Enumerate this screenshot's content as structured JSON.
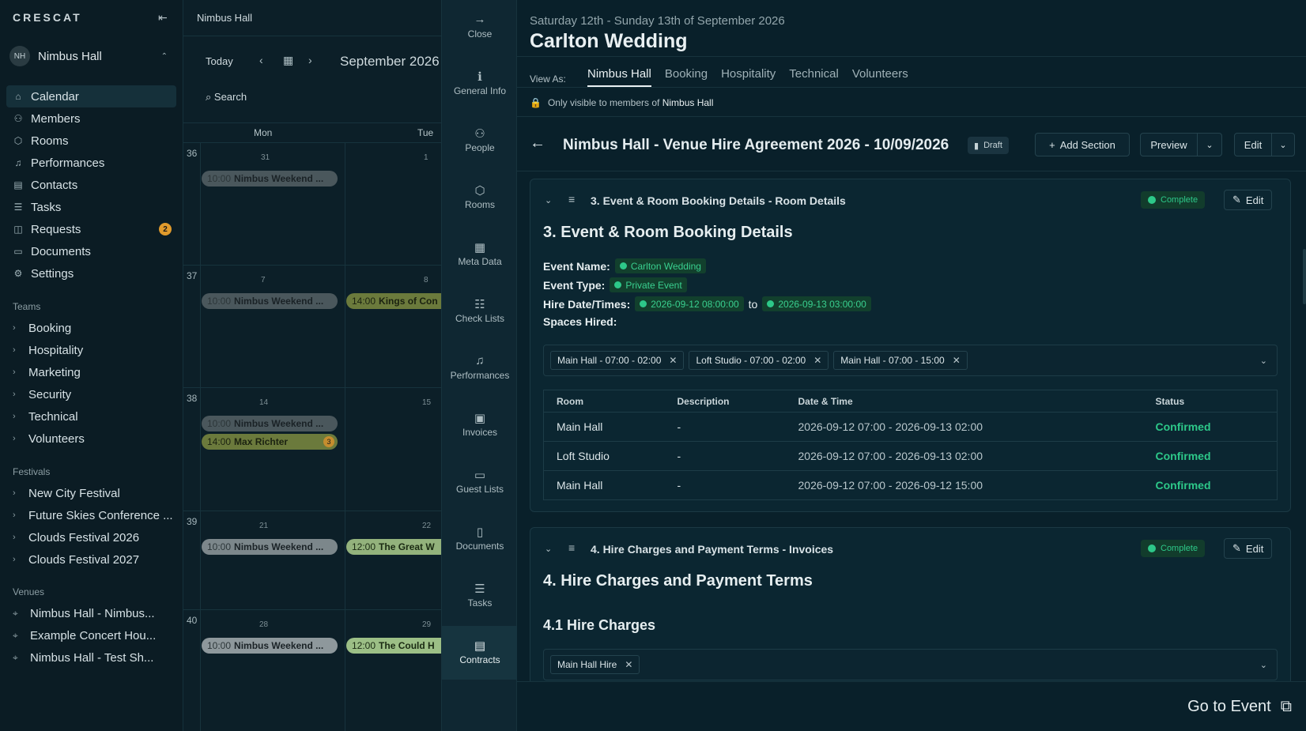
{
  "sidebar": {
    "logo": "CRESCAT",
    "org": {
      "initials": "NH",
      "name": "Nimbus Hall"
    },
    "nav": [
      {
        "label": "Calendar",
        "icon": "home-icon"
      },
      {
        "label": "Members",
        "icon": "users-icon"
      },
      {
        "label": "Rooms",
        "icon": "cube-icon"
      },
      {
        "label": "Performances",
        "icon": "music-icon"
      },
      {
        "label": "Contacts",
        "icon": "contacts-icon"
      },
      {
        "label": "Tasks",
        "icon": "tasks-icon"
      },
      {
        "label": "Requests",
        "icon": "inbox-icon",
        "badge": "2"
      },
      {
        "label": "Documents",
        "icon": "folder-icon"
      },
      {
        "label": "Settings",
        "icon": "gear-icon"
      }
    ],
    "teams_label": "Teams",
    "teams": [
      "Booking",
      "Hospitality",
      "Marketing",
      "Security",
      "Technical",
      "Volunteers"
    ],
    "festivals_label": "Festivals",
    "festivals": [
      "New City Festival",
      "Future Skies Conference ...",
      "Clouds Festival 2026",
      "Clouds Festival 2027"
    ],
    "venues_label": "Venues",
    "venues": [
      "Nimbus Hall - Nimbus...",
      "Example Concert Hou...",
      "Nimbus Hall - Test Sh..."
    ]
  },
  "calendar": {
    "title": "Nimbus Hall",
    "today": "Today",
    "month": "September 2026",
    "search": "Search",
    "days": [
      "Mon",
      "Tue"
    ],
    "weeks": [
      {
        "num": "36",
        "dates": [
          "31",
          "1"
        ]
      },
      {
        "num": "37",
        "dates": [
          "7",
          "8"
        ]
      },
      {
        "num": "38",
        "dates": [
          "14",
          "15"
        ]
      },
      {
        "num": "39",
        "dates": [
          "21",
          "22"
        ]
      },
      {
        "num": "40",
        "dates": [
          "28",
          "29"
        ]
      }
    ],
    "events": [
      {
        "time": "10:00",
        "name": "Nimbus Weekend ..."
      },
      {
        "time": "10:00",
        "name": "Nimbus Weekend ..."
      },
      {
        "time": "14:00",
        "name": "Kings of Con"
      },
      {
        "time": "10:00",
        "name": "Nimbus Weekend ..."
      },
      {
        "time": "14:00",
        "name": "Max Richter",
        "count": "3"
      },
      {
        "time": "10:00",
        "name": "Nimbus Weekend ..."
      },
      {
        "time": "12:00",
        "name": "The Great W"
      },
      {
        "time": "10:00",
        "name": "Nimbus Weekend ..."
      },
      {
        "time": "12:00",
        "name": "The Could H"
      }
    ]
  },
  "tools": [
    {
      "label": "Close",
      "icon": "arrow-right-icon"
    },
    {
      "label": "General Info",
      "icon": "info-icon"
    },
    {
      "label": "People",
      "icon": "people-icon"
    },
    {
      "label": "Rooms",
      "icon": "cube-icon"
    },
    {
      "label": "Meta Data",
      "icon": "table-icon"
    },
    {
      "label": "Check Lists",
      "icon": "checklist-icon"
    },
    {
      "label": "Performances",
      "icon": "music-icon"
    },
    {
      "label": "Invoices",
      "icon": "invoice-icon"
    },
    {
      "label": "Guest Lists",
      "icon": "ticket-icon"
    },
    {
      "label": "Documents",
      "icon": "document-icon"
    },
    {
      "label": "Tasks",
      "icon": "tasks-icon"
    },
    {
      "label": "Contracts",
      "icon": "contract-icon"
    }
  ],
  "event": {
    "dates": "Saturday 12th - Sunday 13th of September 2026",
    "title": "Carlton Wedding",
    "view_as_label": "View As:",
    "tabs": [
      "Nimbus Hall",
      "Booking",
      "Hospitality",
      "Technical",
      "Volunteers"
    ],
    "visibility_prefix": "Only visible to members of",
    "visibility_org": "Nimbus Hall"
  },
  "contract": {
    "title": "Nimbus Hall - Venue Hire Agreement 2026 - 10/09/2026",
    "status": "Draft",
    "add_section": "Add Section",
    "preview": "Preview",
    "edit": "Edit"
  },
  "section3": {
    "header": "3. Event & Room Booking Details - Room Details",
    "status": "Complete",
    "edit": "Edit",
    "heading": "3. Event & Room Booking Details",
    "event_name_label": "Event Name:",
    "event_name": "Carlton Wedding",
    "event_type_label": "Event Type:",
    "event_type": "Private Event",
    "hire_label": "Hire Date/Times:",
    "hire_from": "2026-09-12 08:00:00",
    "hire_to_word": "to",
    "hire_to": "2026-09-13 03:00:00",
    "spaces_label": "Spaces Hired:",
    "chips": [
      "Main Hall - 07:00 - 02:00",
      "Loft Studio - 07:00 - 02:00",
      "Main Hall - 07:00 - 15:00"
    ],
    "table": {
      "headers": [
        "Room",
        "Description",
        "Date & Time",
        "Status"
      ],
      "rows": [
        [
          "Main Hall",
          "-",
          "2026-09-12 07:00 - 2026-09-13 02:00",
          "Confirmed"
        ],
        [
          "Loft Studio",
          "-",
          "2026-09-12 07:00 - 2026-09-13 02:00",
          "Confirmed"
        ],
        [
          "Main Hall",
          "-",
          "2026-09-12 07:00 - 2026-09-12 15:00",
          "Confirmed"
        ]
      ]
    }
  },
  "section4": {
    "header": "4. Hire Charges and Payment Terms - Invoices",
    "status": "Complete",
    "edit": "Edit",
    "heading": "4. Hire Charges and Payment Terms",
    "subheading": "4.1 Hire Charges",
    "chips": [
      "Main Hall Hire"
    ]
  },
  "footer": {
    "go_to_event": "Go to Event"
  },
  "colors": {
    "accent_green": "#2dc889",
    "badge_orange": "#e09a2c",
    "background": "#09202a"
  }
}
